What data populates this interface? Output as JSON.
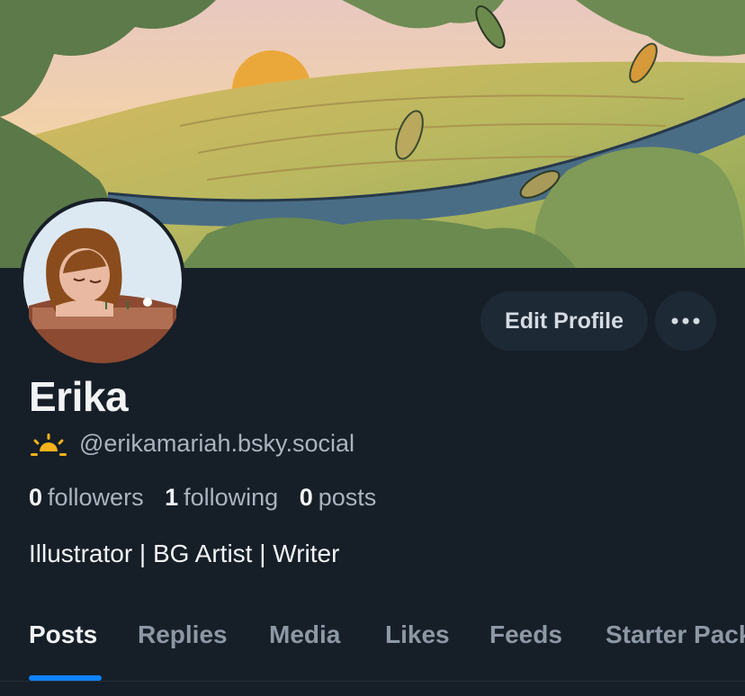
{
  "profile": {
    "display_name": "Erika",
    "handle": "@erikamariah.bsky.social",
    "handle_icon": "sunrise-icon",
    "bio": "Illustrator | BG Artist | Writer",
    "stats": {
      "followers_count": "0",
      "followers_label": "followers",
      "following_count": "1",
      "following_label": "following",
      "posts_count": "0",
      "posts_label": "posts"
    }
  },
  "actions": {
    "edit_label": "Edit Profile",
    "more_icon": "ellipsis-icon"
  },
  "tabs": [
    {
      "label": "Posts",
      "active": true
    },
    {
      "label": "Replies",
      "active": false
    },
    {
      "label": "Media",
      "active": false
    },
    {
      "label": "Likes",
      "active": false
    },
    {
      "label": "Feeds",
      "active": false
    },
    {
      "label": "Starter Packs",
      "active": false
    }
  ],
  "colors": {
    "background": "#161e27",
    "button": "#1e2936",
    "accent": "#1083fe",
    "text_primary": "#f1f3f5",
    "text_secondary": "#aab4bf"
  }
}
